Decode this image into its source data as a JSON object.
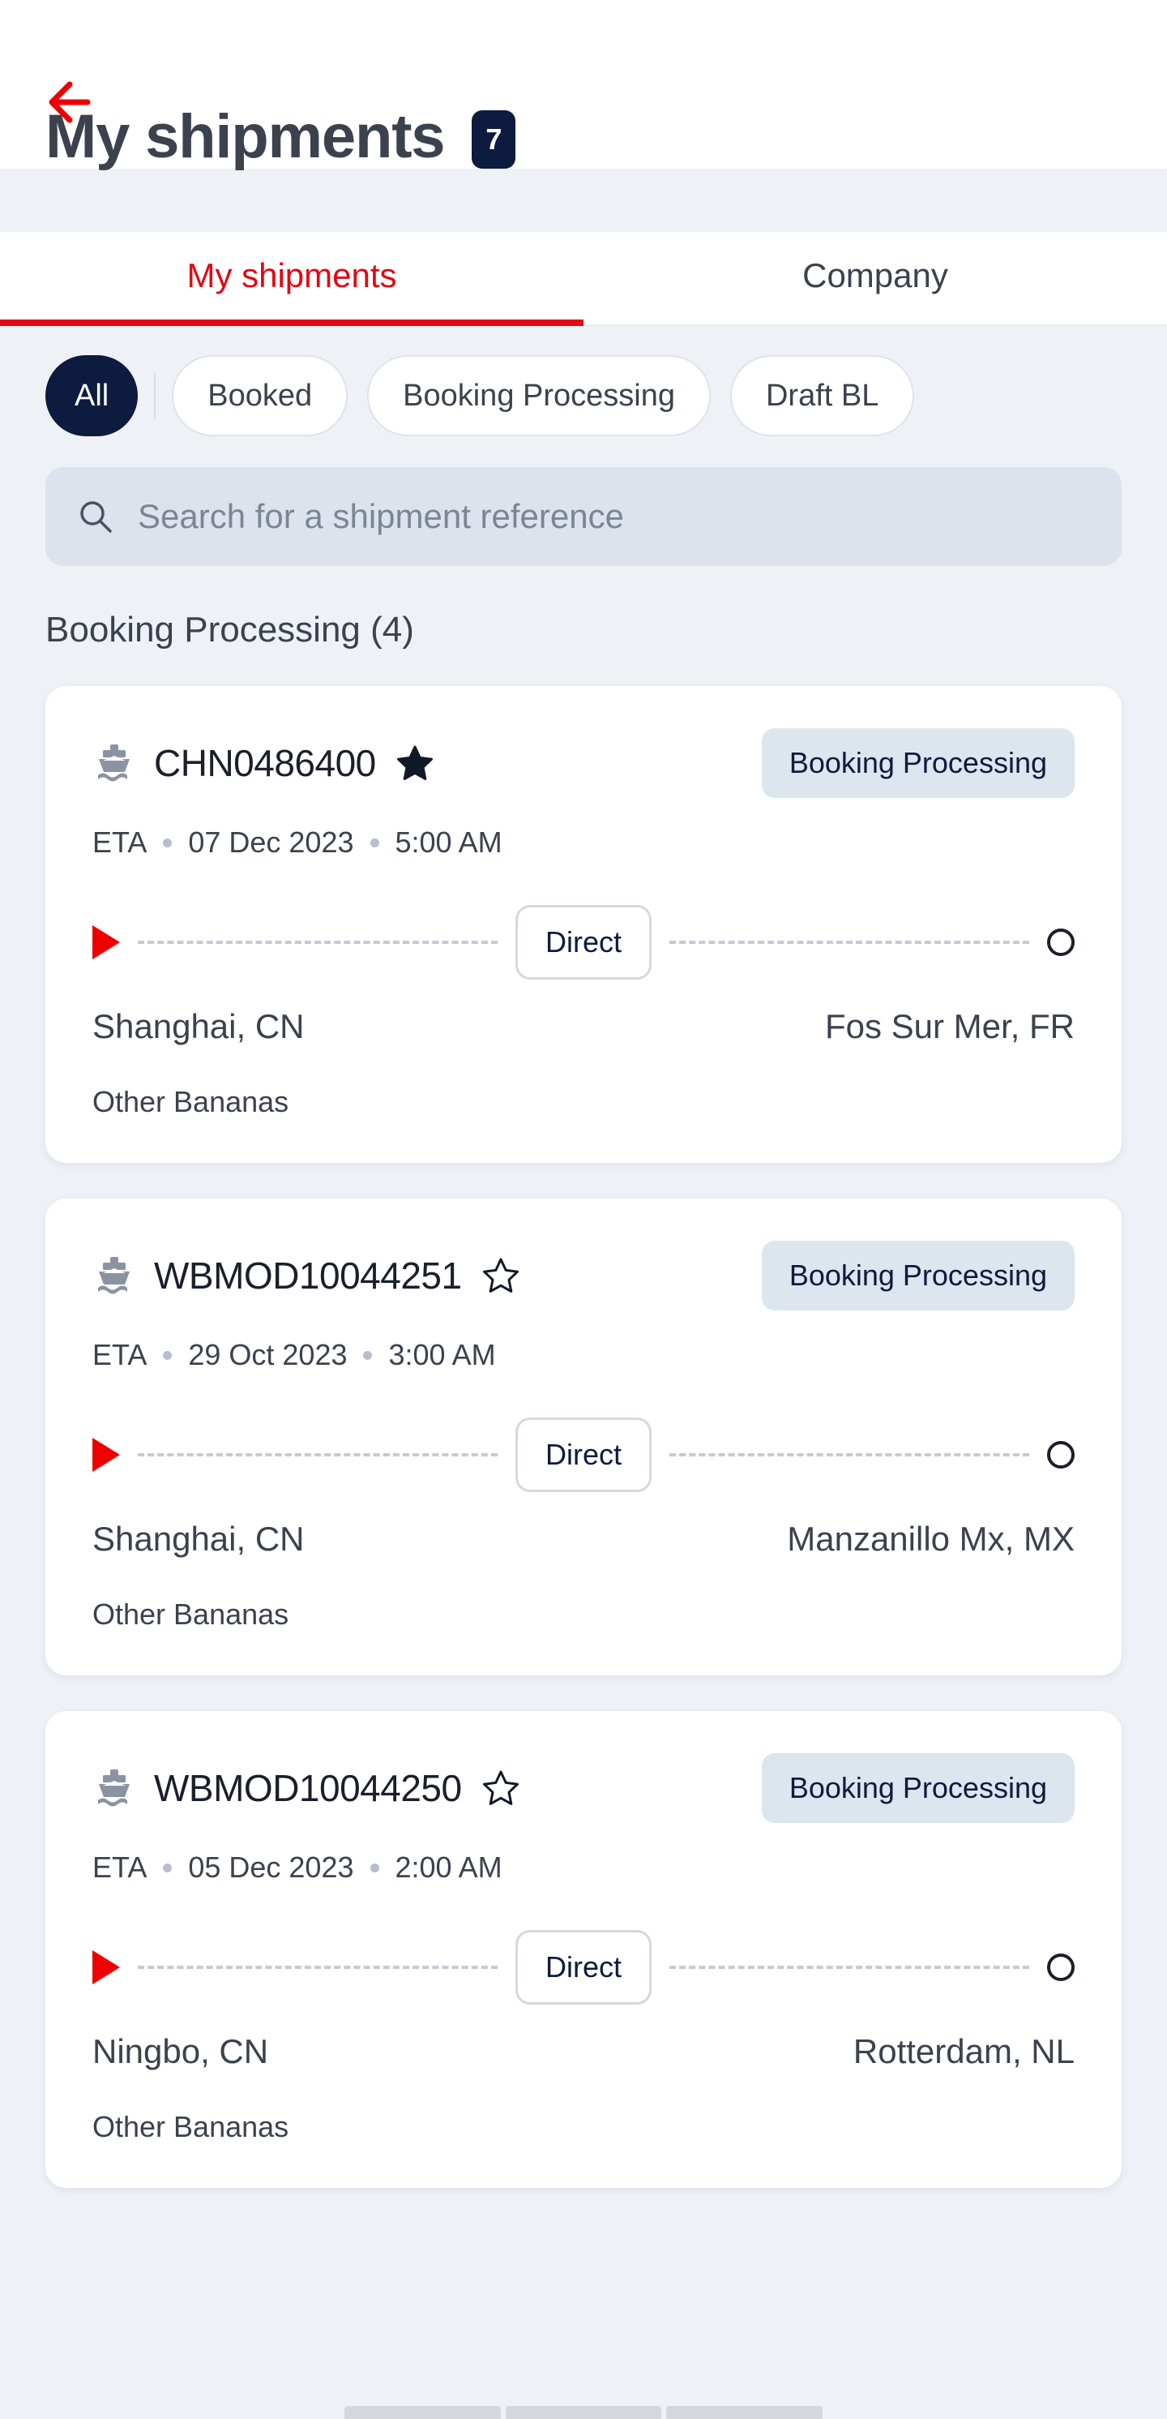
{
  "header": {
    "back_icon": "arrow-left-icon",
    "title": "My shipments",
    "count": "7",
    "accent_red": "#e30613",
    "navy": "#0d1b3e"
  },
  "tabs": [
    {
      "label": "My shipments",
      "active": true
    },
    {
      "label": "Company",
      "active": false
    }
  ],
  "filters": {
    "chips": [
      {
        "label": "All",
        "active": true
      },
      {
        "label": "Booked",
        "active": false
      },
      {
        "label": "Booking Processing",
        "active": false
      },
      {
        "label": "Draft BL",
        "active": false
      }
    ]
  },
  "search": {
    "icon": "search-icon",
    "placeholder": "Search for a shipment reference",
    "value": ""
  },
  "section": {
    "title": "Booking Processing (4)"
  },
  "labels": {
    "eta": "ETA",
    "mode": "Direct"
  },
  "shipments": [
    {
      "icon": "ship-icon",
      "reference": "CHN0486400",
      "favorite": true,
      "status": "Booking Processing",
      "eta_label": "ETA",
      "eta_date": "07 Dec 2023",
      "eta_time": "5:00 AM",
      "mode": "Direct",
      "origin": "Shanghai, CN",
      "destination": "Fos Sur Mer, FR",
      "cargo": "Other Bananas"
    },
    {
      "icon": "ship-icon",
      "reference": "WBMOD10044251",
      "favorite": false,
      "status": "Booking Processing",
      "eta_label": "ETA",
      "eta_date": "29 Oct 2023",
      "eta_time": "3:00 AM",
      "mode": "Direct",
      "origin": "Shanghai, CN",
      "destination": "Manzanillo Mx, MX",
      "cargo": "Other Bananas"
    },
    {
      "icon": "ship-icon",
      "reference": "WBMOD10044250",
      "favorite": false,
      "status": "Booking Processing",
      "eta_label": "ETA",
      "eta_date": "05 Dec 2023",
      "eta_time": "2:00 AM",
      "mode": "Direct",
      "origin": "Ningbo, CN",
      "destination": "Rotterdam, NL",
      "cargo": "Other Bananas"
    }
  ]
}
